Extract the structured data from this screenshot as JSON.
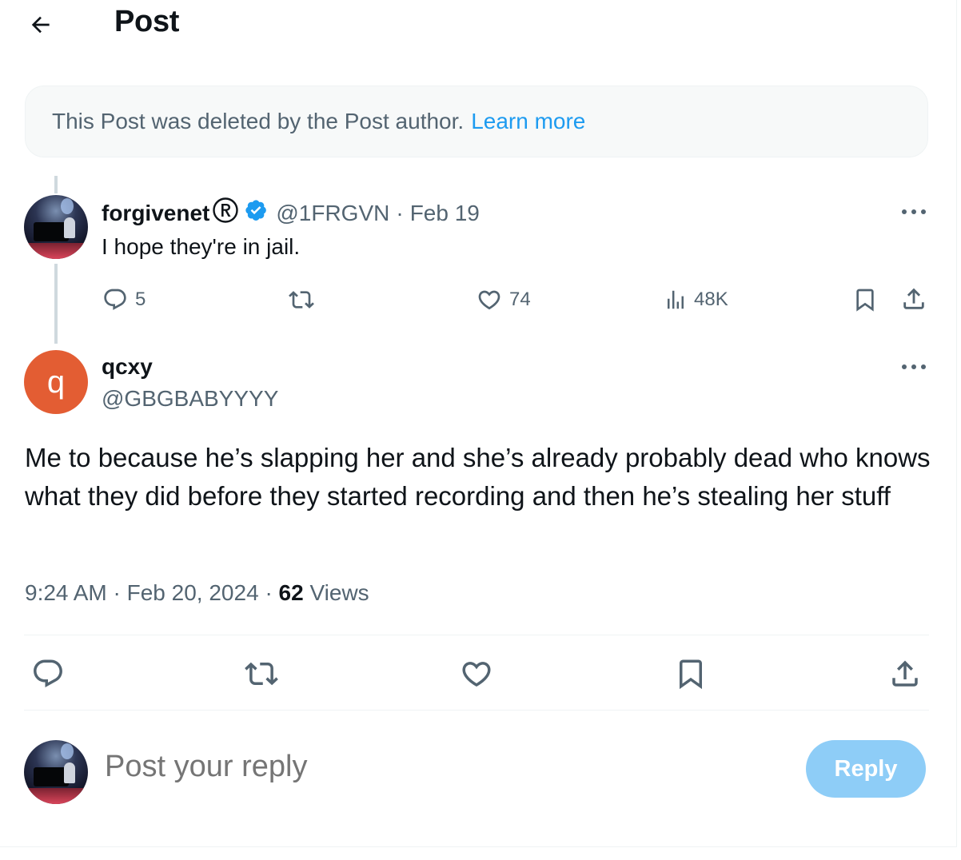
{
  "header": {
    "title": "Post"
  },
  "notice": {
    "text": "This Post was deleted by the Post author.",
    "link": "Learn more"
  },
  "parent_post": {
    "name": "forgivenet",
    "handle": "@1FRGVN",
    "separator": "·",
    "date": "Feb 19",
    "text": "I hope they're in jail.",
    "stats": {
      "replies": "5",
      "likes": "74",
      "views": "48K"
    }
  },
  "main_post": {
    "avatar_letter": "q",
    "name": "qcxy",
    "handle": "@GBGBABYYYY",
    "text": "Me to because he’s slapping her and she’s already probably dead who knows what they did before they started recording and then he’s stealing her stuff",
    "time": "9:24 AM",
    "sep1": "·",
    "date": "Feb 20, 2024",
    "sep2": "·",
    "views_count": "62",
    "views_label": "Views"
  },
  "composer": {
    "placeholder": "Post your reply",
    "button": "Reply"
  },
  "colors": {
    "accent": "#1d9bf0",
    "muted": "#536471",
    "avatar_q": "#e35d33",
    "reply_button": "#8ecdf7"
  }
}
